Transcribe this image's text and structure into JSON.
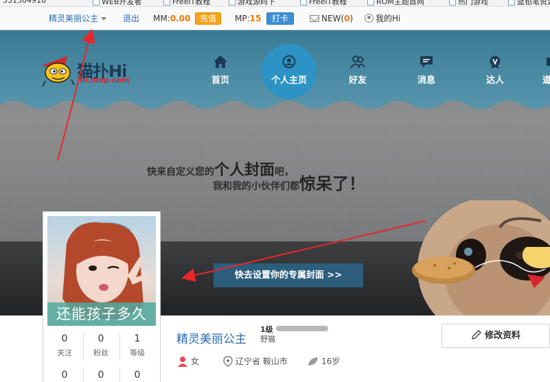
{
  "bookmarks": [
    {
      "label": "531504918"
    },
    {
      "label": "WEB开发者"
    },
    {
      "label": "FreeIT教程"
    },
    {
      "label": "游戏源码下"
    },
    {
      "label": "FreeIT教程"
    },
    {
      "label": "ROM主题首网"
    },
    {
      "label": "热门游戏"
    },
    {
      "label": "蓝铅笔资源"
    }
  ],
  "topbar": {
    "username": "精灵美丽公主",
    "logout": "退出",
    "mm_label": "MM:",
    "mm_value": "0.00",
    "charge_label": "充值",
    "mp_label": "MP:",
    "mp_value": "15",
    "checkin_label": "打卡",
    "new_label": "NEW(",
    "new_count": "0",
    "new_close": ")",
    "my_hi": "我的Hi"
  },
  "logo": {
    "text": "猫扑Hi",
    "sub": "hi.mop.com"
  },
  "nav": {
    "items": [
      {
        "label": "首页"
      },
      {
        "label": "个人主页"
      },
      {
        "label": "好友"
      },
      {
        "label": "消息"
      },
      {
        "label": "达人"
      },
      {
        "label": "道"
      }
    ]
  },
  "banner": {
    "line1_a": "快来自定义您的",
    "line1_big": "个人封面",
    "line1_b": "吧，",
    "line2_a": "我和我的小伙伴们都",
    "line2_big": "惊呆了！",
    "cover_button": "快去设置你的专属封面 >>"
  },
  "profile": {
    "avatar_name": "还能孩子多久",
    "stats": [
      {
        "num": "0",
        "label": "关注"
      },
      {
        "num": "0",
        "label": "粉丝"
      },
      {
        "num": "1",
        "label": "等级"
      }
    ],
    "stats_row2": [
      "0",
      "0",
      "0"
    ],
    "name": "精灵美丽公主",
    "level": "1级",
    "level_title": "野猫",
    "edit_button": "修改资料",
    "gender": "女",
    "location": "辽宁省 鞍山市",
    "age": "16岁"
  },
  "colors": {
    "nav_bg": "#4a8aa3",
    "nav_active": "#2c93c4",
    "accent_orange": "#f07b00",
    "link_blue": "#2a6ab1",
    "annotation_red": "#e8262b"
  }
}
